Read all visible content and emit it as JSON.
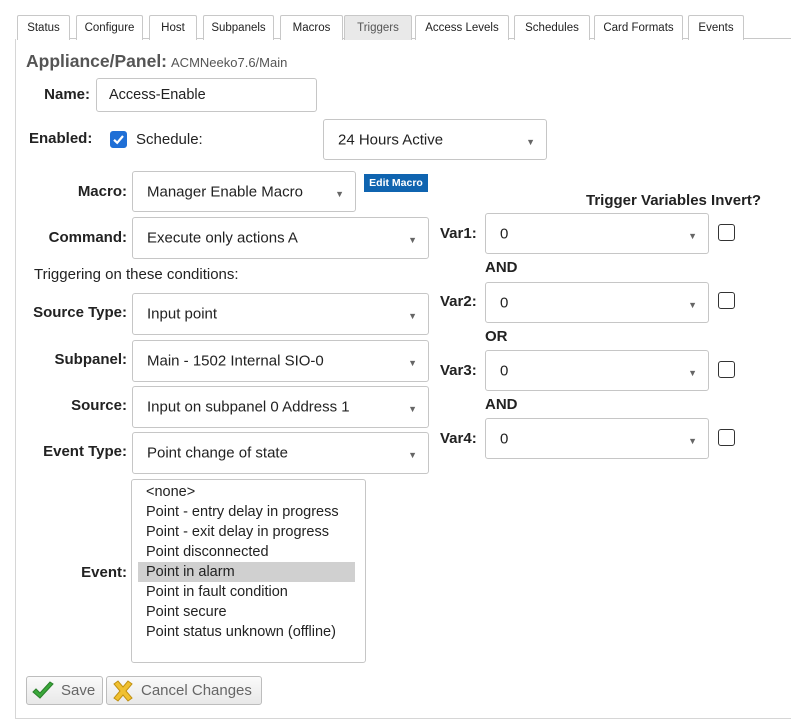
{
  "tabs": [
    {
      "label": "Status"
    },
    {
      "label": "Configure"
    },
    {
      "label": "Host"
    },
    {
      "label": "Subpanels"
    },
    {
      "label": "Macros"
    },
    {
      "label": "Triggers"
    },
    {
      "label": "Access Levels"
    },
    {
      "label": "Schedules"
    },
    {
      "label": "Card Formats"
    },
    {
      "label": "Events"
    }
  ],
  "active_tab": "Triggers",
  "header": {
    "title": "Appliance/Panel:",
    "path": "ACMNeeko7.6/Main"
  },
  "form": {
    "name_label": "Name:",
    "name_value": "Access-Enable",
    "enabled_label": "Enabled:",
    "enabled_checked": true,
    "schedule_label": "Schedule:",
    "schedule_value": "24 Hours Active",
    "macro_label": "Macro:",
    "macro_value": "Manager Enable Macro",
    "edit_macro_label": "Edit Macro",
    "command_label": "Command:",
    "command_value": "Execute only actions A",
    "conditions_text": "Triggering on these conditions:",
    "source_type_label": "Source Type:",
    "source_type_value": "Input point",
    "subpanel_label": "Subpanel:",
    "subpanel_value": "Main - 1502 Internal SIO-0",
    "source_label": "Source:",
    "source_value": "Input on subpanel 0 Address 1",
    "event_type_label": "Event Type:",
    "event_type_value": "Point change of state",
    "event_label": "Event:",
    "event_options": [
      "<none>",
      "Point - entry delay in progress",
      "Point - exit delay in progress",
      "Point disconnected",
      "Point in alarm",
      "Point in fault condition",
      "Point secure",
      "Point status unknown (offline)"
    ],
    "event_selected": "Point in alarm"
  },
  "trigger_vars": {
    "header": "Trigger Variables Invert?",
    "vars": [
      {
        "label": "Var1:",
        "value": "0",
        "invert": false
      },
      {
        "label": "Var2:",
        "value": "0",
        "invert": false
      },
      {
        "label": "Var3:",
        "value": "0",
        "invert": false
      },
      {
        "label": "Var4:",
        "value": "0",
        "invert": false
      }
    ],
    "operators": [
      "AND",
      "OR",
      "AND"
    ]
  },
  "buttons": {
    "save_label": "Save",
    "cancel_label": "Cancel Changes"
  },
  "colors": {
    "accent": "#1f6fd6",
    "edit_macro_bg": "#0f64b0",
    "save_icon": "#3aa83a",
    "cancel_icon": "#f0c030"
  }
}
